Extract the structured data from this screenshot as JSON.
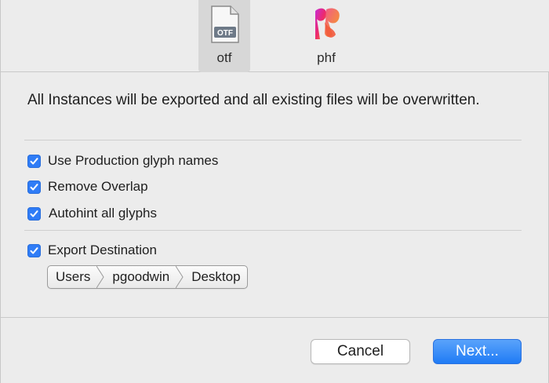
{
  "toolbar": {
    "tabs": [
      {
        "label": "otf",
        "icon": "otf-file-icon",
        "icon_text": "OTF",
        "selected": true
      },
      {
        "label": "phf",
        "icon": "phf-logo-icon",
        "selected": false
      }
    ]
  },
  "main": {
    "message": "All Instances will be exported and all existing files will be overwritten.",
    "options": [
      {
        "label": "Use Production glyph names",
        "checked": true
      },
      {
        "label": "Remove Overlap",
        "checked": true
      },
      {
        "label": "Autohint all glyphs",
        "checked": true
      },
      {
        "label": "Export Destination",
        "checked": true
      }
    ],
    "path": [
      "Users",
      "pgoodwin",
      "Desktop"
    ]
  },
  "buttons": {
    "cancel_label": "Cancel",
    "next_label": "Next..."
  },
  "colors": {
    "accent": "#2f7cf6",
    "background": "#ececec",
    "selected_tab": "#d7d7d7"
  }
}
